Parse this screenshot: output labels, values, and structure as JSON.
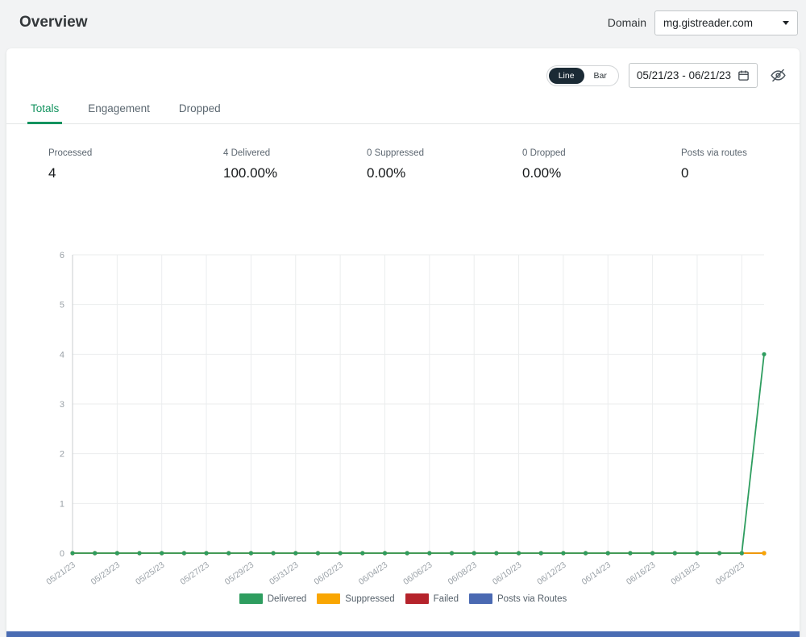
{
  "page": {
    "title": "Overview"
  },
  "domain_selector": {
    "label": "Domain",
    "value": "mg.gistreader.com"
  },
  "controls": {
    "toggle": {
      "line": "Line",
      "bar": "Bar",
      "selected": "Line"
    },
    "date_range": "05/21/23 - 06/21/23"
  },
  "icons": [
    "caret-down-icon",
    "calendar-icon",
    "eye-off-icon"
  ],
  "tabs": [
    {
      "label": "Totals"
    },
    {
      "label": "Engagement"
    },
    {
      "label": "Dropped"
    }
  ],
  "active_tab": "Totals",
  "stats": [
    {
      "label": "Processed",
      "value": "4"
    },
    {
      "label": "4 Delivered",
      "value": "100.00%"
    },
    {
      "label": "0 Suppressed",
      "value": "0.00%"
    },
    {
      "label": "0 Dropped",
      "value": "0.00%"
    },
    {
      "label": "Posts via routes",
      "value": "0"
    }
  ],
  "colors": {
    "accent_green": "#13935f",
    "toggle_dark": "#1b2a35",
    "bottom_bar_blue": "#4a6cb3"
  },
  "chart_data": {
    "type": "line",
    "title": "",
    "xlabel": "",
    "ylabel": "",
    "ylim": [
      0,
      6
    ],
    "yticks": [
      0,
      1,
      2,
      3,
      4,
      5,
      6
    ],
    "grid": true,
    "legend_position": "bottom",
    "x_tick_interval": 2,
    "x": [
      "05/21/23",
      "05/22/23",
      "05/23/23",
      "05/24/23",
      "05/25/23",
      "05/26/23",
      "05/27/23",
      "05/28/23",
      "05/29/23",
      "05/30/23",
      "05/31/23",
      "06/01/23",
      "06/02/23",
      "06/03/23",
      "06/04/23",
      "06/05/23",
      "06/06/23",
      "06/07/23",
      "06/08/23",
      "06/09/23",
      "06/10/23",
      "06/11/23",
      "06/12/23",
      "06/13/23",
      "06/14/23",
      "06/15/23",
      "06/16/23",
      "06/17/23",
      "06/18/23",
      "06/19/23",
      "06/20/23",
      "06/21/23"
    ],
    "series": [
      {
        "name": "Delivered",
        "color": "#2e9d5f",
        "values": [
          0,
          0,
          0,
          0,
          0,
          0,
          0,
          0,
          0,
          0,
          0,
          0,
          0,
          0,
          0,
          0,
          0,
          0,
          0,
          0,
          0,
          0,
          0,
          0,
          0,
          0,
          0,
          0,
          0,
          0,
          0,
          4
        ]
      },
      {
        "name": "Suppressed",
        "color": "#f9a602",
        "values": [
          0,
          0,
          0,
          0,
          0,
          0,
          0,
          0,
          0,
          0,
          0,
          0,
          0,
          0,
          0,
          0,
          0,
          0,
          0,
          0,
          0,
          0,
          0,
          0,
          0,
          0,
          0,
          0,
          0,
          0,
          0,
          0
        ]
      },
      {
        "name": "Failed",
        "color": "#b5232b",
        "values": [
          0,
          0,
          0,
          0,
          0,
          0,
          0,
          0,
          0,
          0,
          0,
          0,
          0,
          0,
          0,
          0,
          0,
          0,
          0,
          0,
          0,
          0,
          0,
          0,
          0,
          0,
          0,
          0,
          0,
          0,
          0,
          0
        ]
      },
      {
        "name": "Posts via Routes",
        "color": "#4a69b2",
        "values": [
          0,
          0,
          0,
          0,
          0,
          0,
          0,
          0,
          0,
          0,
          0,
          0,
          0,
          0,
          0,
          0,
          0,
          0,
          0,
          0,
          0,
          0,
          0,
          0,
          0,
          0,
          0,
          0,
          0,
          0,
          0,
          0
        ]
      }
    ]
  }
}
